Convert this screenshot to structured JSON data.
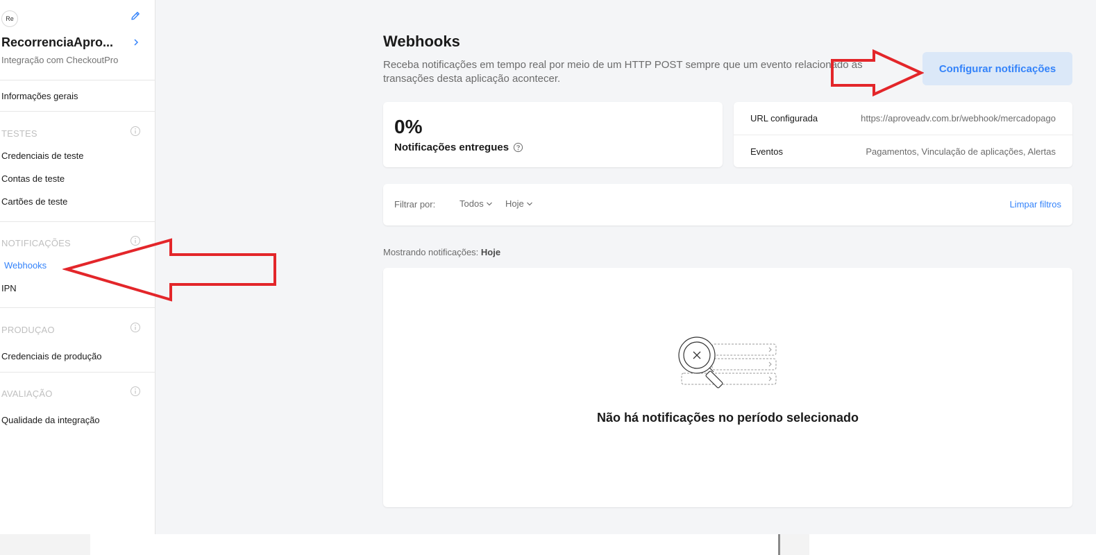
{
  "sidebar": {
    "avatar_initials": "Re",
    "app_name": "RecorrenciaApro...",
    "app_subtitle": "Integração com CheckoutPro",
    "general_info": "Informações gerais",
    "sections": {
      "tests": {
        "title": "TESTES",
        "items": [
          "Credenciais de teste",
          "Contas de teste",
          "Cartões de teste"
        ]
      },
      "notifications": {
        "title": "NOTIFICAÇÕES",
        "items": [
          "Webhooks",
          "IPN"
        ]
      },
      "production": {
        "title": "PRODUÇAO",
        "items": [
          "Credenciais de produção"
        ]
      },
      "evaluation": {
        "title": "AVALIAÇÃO",
        "items": [
          "Qualidade da integração"
        ]
      }
    },
    "active_item": "Webhooks"
  },
  "main": {
    "title": "Webhooks",
    "description": "Receba notificações em tempo real por meio de um HTTP POST sempre que um evento relacionado às transações desta aplicação acontecer.",
    "configure_button": "Configurar notificações",
    "delivery_rate": {
      "value": "0%",
      "label": "Notificações entregues"
    },
    "config": {
      "url_label": "URL configurada",
      "url_value": "https://aproveadv.com.br/webhook/mercadopago",
      "events_label": "Eventos",
      "events_value": "Pagamentos, Vinculação de aplicações, Alertas"
    },
    "filters": {
      "label": "Filtrar por:",
      "type": "Todos",
      "period": "Hoje",
      "clear": "Limpar filtros"
    },
    "showing_label": "Mostrando notificações:",
    "showing_value": "Hoje",
    "empty_message": "Não há notificações no período selecionado"
  },
  "colors": {
    "accent": "#3483fa",
    "annotation": "#e3262a",
    "button_bg": "#dbe8f8"
  }
}
